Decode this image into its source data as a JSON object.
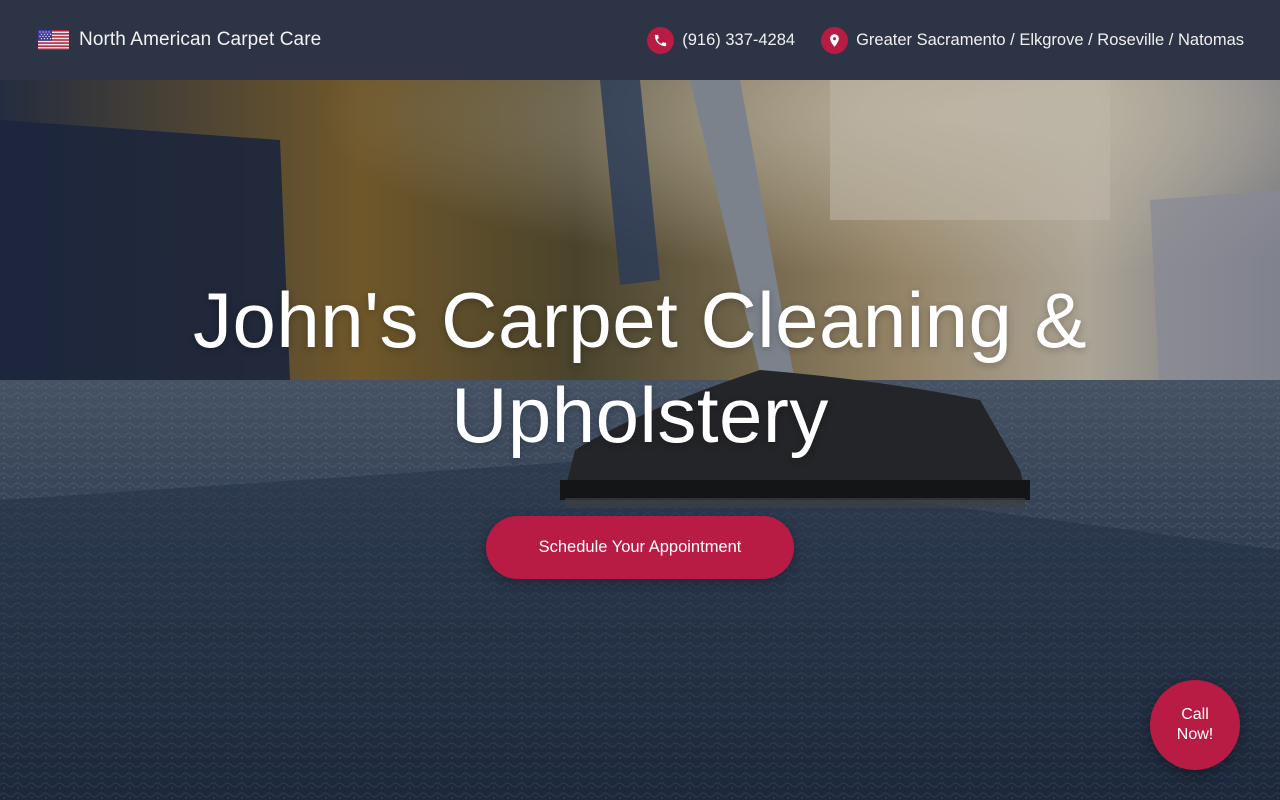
{
  "header": {
    "brand_name": "North American Carpet Care",
    "flag_icon": "us-flag-icon",
    "phone": {
      "icon": "phone-icon",
      "text": "(916) 337-4284"
    },
    "location": {
      "icon": "map-pin-icon",
      "text": "Greater Sacramento / Elkgrove / Roseville / Natomas"
    }
  },
  "hero": {
    "title": "John's Carpet Cleaning & Upholstery",
    "cta_label": "Schedule Your Appointment",
    "background": "carpet-vacuum-photo"
  },
  "floating": {
    "call_label": "Call Now!"
  },
  "colors": {
    "header_bg": "#2d3445",
    "accent": "#b81c44",
    "text": "#ffffff"
  }
}
